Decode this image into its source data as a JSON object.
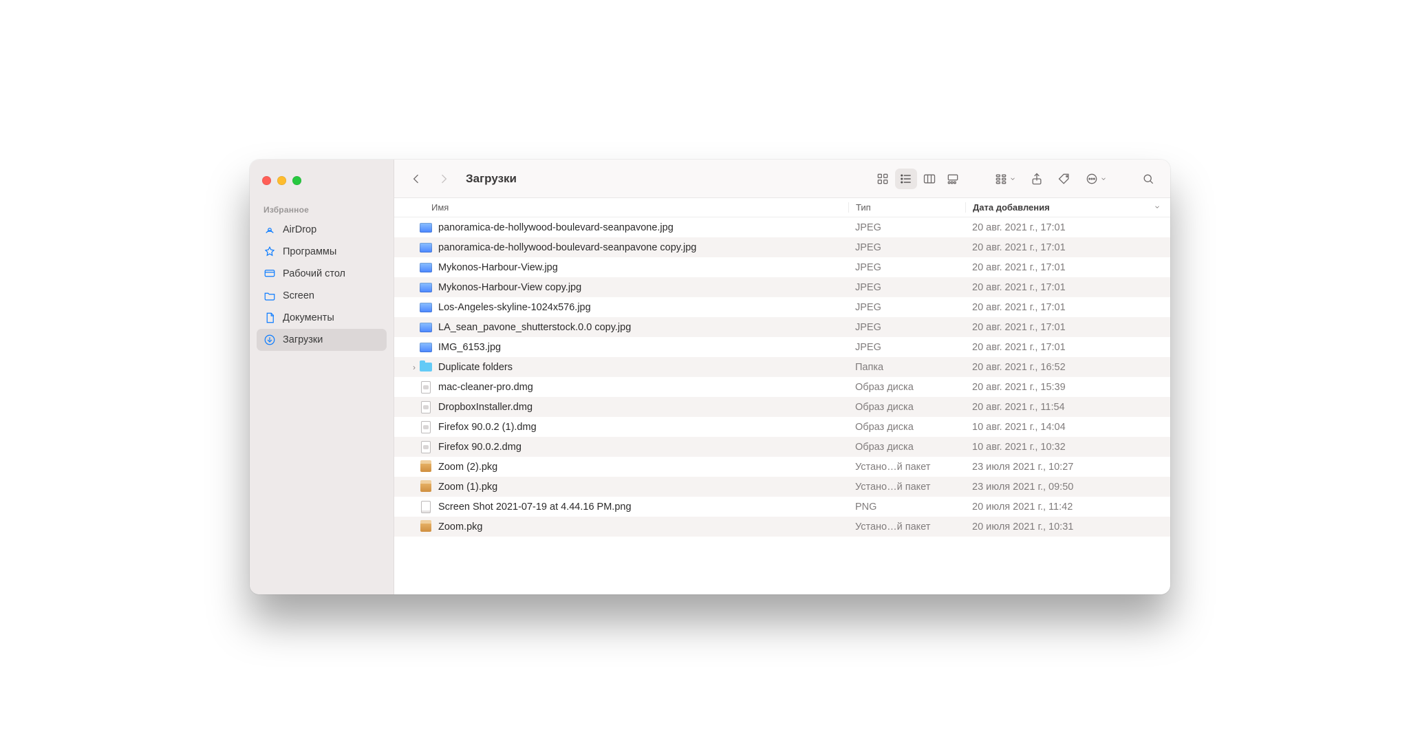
{
  "window_title": "Загрузки",
  "sidebar": {
    "section_label": "Избранное",
    "items": [
      {
        "label": "AirDrop",
        "icon": "airdrop",
        "selected": false
      },
      {
        "label": "Программы",
        "icon": "apps",
        "selected": false
      },
      {
        "label": "Рабочий стол",
        "icon": "desktop",
        "selected": false
      },
      {
        "label": "Screen",
        "icon": "folder",
        "selected": false
      },
      {
        "label": "Документы",
        "icon": "document",
        "selected": false
      },
      {
        "label": "Загрузки",
        "icon": "downloads",
        "selected": true
      }
    ]
  },
  "columns": {
    "name_label": "Имя",
    "type_label": "Тип",
    "date_label": "Дата добавления"
  },
  "files": [
    {
      "name": "panoramica-de-hollywood-boulevard-seanpavone.jpg",
      "type": "JPEG",
      "date": "20 авг. 2021 г., 17:01",
      "icon": "jpeg",
      "folder": false
    },
    {
      "name": "panoramica-de-hollywood-boulevard-seanpavone copy.jpg",
      "type": "JPEG",
      "date": "20 авг. 2021 г., 17:01",
      "icon": "jpeg",
      "folder": false
    },
    {
      "name": "Mykonos-Harbour-View.jpg",
      "type": "JPEG",
      "date": "20 авг. 2021 г., 17:01",
      "icon": "jpeg",
      "folder": false
    },
    {
      "name": "Mykonos-Harbour-View copy.jpg",
      "type": "JPEG",
      "date": "20 авг. 2021 г., 17:01",
      "icon": "jpeg",
      "folder": false
    },
    {
      "name": "Los-Angeles-skyline-1024x576.jpg",
      "type": "JPEG",
      "date": "20 авг. 2021 г., 17:01",
      "icon": "jpeg",
      "folder": false
    },
    {
      "name": "LA_sean_pavone_shutterstock.0.0 copy.jpg",
      "type": "JPEG",
      "date": "20 авг. 2021 г., 17:01",
      "icon": "jpeg",
      "folder": false
    },
    {
      "name": "IMG_6153.jpg",
      "type": "JPEG",
      "date": "20 авг. 2021 г., 17:01",
      "icon": "jpeg",
      "folder": false
    },
    {
      "name": "Duplicate folders",
      "type": "Папка",
      "date": "20 авг. 2021 г., 16:52",
      "icon": "folder",
      "folder": true
    },
    {
      "name": "mac-cleaner-pro.dmg",
      "type": "Образ диска",
      "date": "20 авг. 2021 г., 15:39",
      "icon": "dmg",
      "folder": false
    },
    {
      "name": "DropboxInstaller.dmg",
      "type": "Образ диска",
      "date": "20 авг. 2021 г., 11:54",
      "icon": "dmg",
      "folder": false
    },
    {
      "name": "Firefox 90.0.2 (1).dmg",
      "type": "Образ диска",
      "date": "10 авг. 2021 г., 14:04",
      "icon": "dmg",
      "folder": false
    },
    {
      "name": "Firefox 90.0.2.dmg",
      "type": "Образ диска",
      "date": "10 авг. 2021 г., 10:32",
      "icon": "dmg",
      "folder": false
    },
    {
      "name": "Zoom (2).pkg",
      "type": "Устано…й пакет",
      "date": "23 июля 2021 г., 10:27",
      "icon": "pkg",
      "folder": false
    },
    {
      "name": "Zoom (1).pkg",
      "type": "Устано…й пакет",
      "date": "23 июля 2021 г., 09:50",
      "icon": "pkg",
      "folder": false
    },
    {
      "name": "Screen Shot 2021-07-19 at 4.44.16 PM.png",
      "type": "PNG",
      "date": "20 июля 2021 г., 11:42",
      "icon": "png",
      "folder": false
    },
    {
      "name": "Zoom.pkg",
      "type": "Устано…й пакет",
      "date": "20 июля 2021 г., 10:31",
      "icon": "pkg",
      "folder": false
    }
  ]
}
